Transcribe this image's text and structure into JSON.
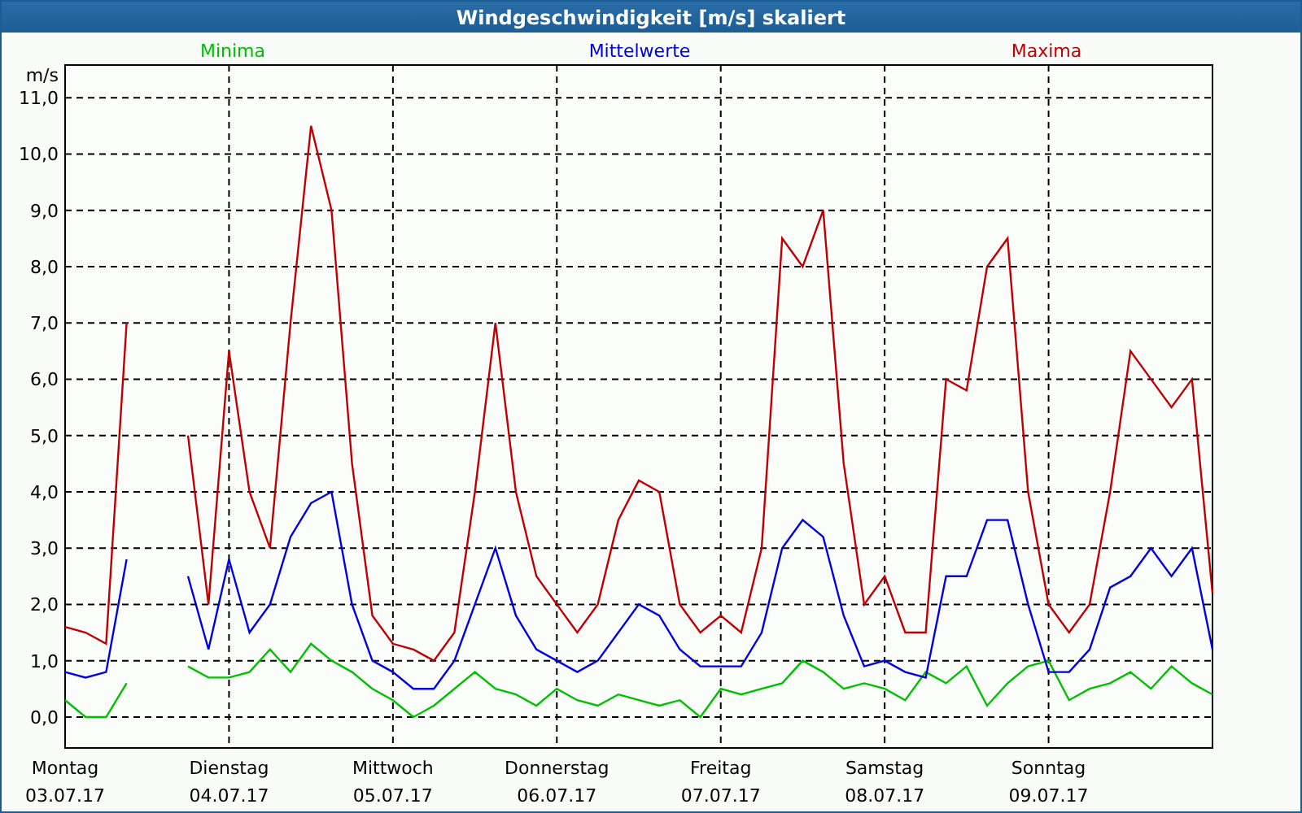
{
  "window": {
    "title": "Windgeschwindigkeit [m/s] skaliert"
  },
  "chart": {
    "dates": [
      "03.07.17",
      "04.07.17",
      "05.07.17",
      "06.07.17",
      "07.07.17",
      "08.07.17",
      "09.07.17"
    ],
    "chart_data": {
      "type": "line",
      "ylabel": "m/s",
      "categories": [
        "Montag",
        null,
        null,
        null,
        null,
        null,
        null,
        null,
        "Dienstag",
        null,
        null,
        null,
        null,
        null,
        null,
        null,
        "Mittwoch",
        null,
        null,
        null,
        null,
        null,
        null,
        null,
        "Donnerstag",
        null,
        null,
        null,
        null,
        null,
        null,
        null,
        "Freitag",
        null,
        null,
        null,
        null,
        null,
        null,
        null,
        "Samstag",
        null,
        null,
        null,
        null,
        null,
        null,
        null,
        "Sonntag",
        null,
        null,
        null,
        null,
        null,
        null,
        null,
        null
      ],
      "ylim": [
        -0.55,
        11.58
      ],
      "grid": true,
      "yticks": [
        {
          "value": 0,
          "label": "0,0"
        },
        {
          "value": 1,
          "label": "1,0"
        },
        {
          "value": 2,
          "label": "2,0"
        },
        {
          "value": 3,
          "label": "3,0"
        },
        {
          "value": 4,
          "label": "4,0"
        },
        {
          "value": 5,
          "label": "5,0"
        },
        {
          "value": 6,
          "label": "6,0"
        },
        {
          "value": 7,
          "label": "7,0"
        },
        {
          "value": 8,
          "label": "8,0"
        },
        {
          "value": 9,
          "label": "9,0"
        },
        {
          "value": 10,
          "label": "10,0"
        },
        {
          "value": 11,
          "label": "11,0"
        }
      ],
      "series": [
        {
          "name": "Minima",
          "color": "#00c000",
          "values": [
            0.3,
            0.0,
            0.0,
            0.6,
            null,
            null,
            0.9,
            0.7,
            0.7,
            0.8,
            1.2,
            0.8,
            1.3,
            1.0,
            0.8,
            0.5,
            0.3,
            0.0,
            0.2,
            0.5,
            0.8,
            0.5,
            0.4,
            0.2,
            0.5,
            0.3,
            0.2,
            0.4,
            0.3,
            0.2,
            0.3,
            0.0,
            0.5,
            0.4,
            0.5,
            0.6,
            1.0,
            0.8,
            0.5,
            0.6,
            0.5,
            0.3,
            0.8,
            0.6,
            0.9,
            0.2,
            0.6,
            0.9,
            1.0,
            0.3,
            0.5,
            0.6,
            0.8,
            0.5,
            0.9,
            0.6,
            0.4
          ]
        },
        {
          "name": "Mittelwerte",
          "color": "#0000e0",
          "values": [
            0.8,
            0.7,
            0.8,
            2.8,
            null,
            null,
            2.5,
            1.2,
            2.8,
            1.5,
            2.0,
            3.2,
            3.8,
            4.0,
            2.0,
            1.0,
            0.8,
            0.5,
            0.5,
            1.0,
            2.0,
            3.0,
            1.8,
            1.2,
            1.0,
            0.8,
            1.0,
            1.5,
            2.0,
            1.8,
            1.2,
            0.9,
            0.9,
            0.9,
            1.5,
            3.0,
            3.5,
            3.2,
            1.8,
            0.9,
            1.0,
            0.8,
            0.7,
            2.5,
            2.5,
            3.5,
            3.5,
            2.0,
            0.8,
            0.8,
            1.2,
            2.3,
            2.5,
            3.0,
            2.5,
            3.0,
            1.2
          ]
        },
        {
          "name": "Maxima",
          "color": "#c00000",
          "values": [
            1.6,
            1.5,
            1.3,
            7.0,
            null,
            null,
            5.0,
            2.0,
            6.5,
            4.0,
            3.0,
            7.0,
            10.5,
            9.0,
            4.5,
            1.8,
            1.3,
            1.2,
            1.0,
            1.5,
            4.0,
            7.0,
            4.0,
            2.5,
            2.0,
            1.5,
            2.0,
            3.5,
            4.2,
            4.0,
            2.0,
            1.5,
            1.8,
            1.5,
            3.0,
            8.5,
            8.0,
            9.0,
            4.5,
            2.0,
            2.5,
            1.5,
            1.5,
            6.0,
            5.8,
            8.0,
            8.5,
            4.0,
            2.0,
            1.5,
            2.0,
            4.0,
            6.5,
            6.0,
            5.5,
            6.0,
            2.2
          ]
        }
      ]
    }
  }
}
